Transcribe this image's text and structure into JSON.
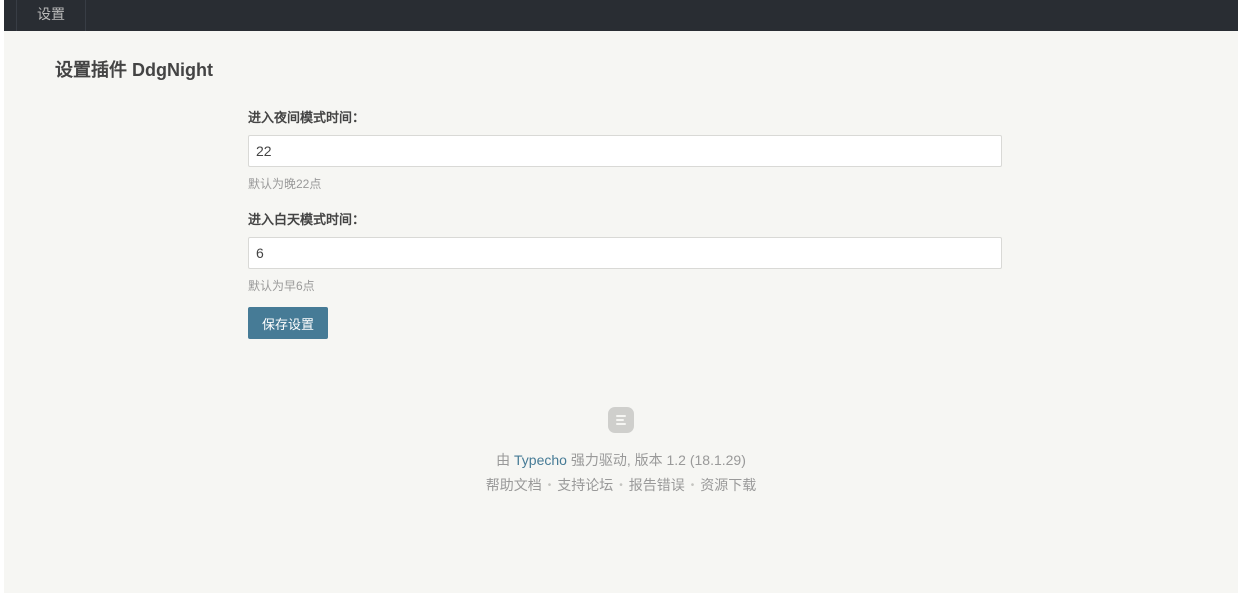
{
  "topbar": {
    "settings_tab": "设置"
  },
  "page": {
    "title": "设置插件 DdgNight"
  },
  "form": {
    "night_start": {
      "label": "进入夜间模式时间：",
      "value": "22",
      "description": "默认为晚22点"
    },
    "day_start": {
      "label": "进入白天模式时间：",
      "value": "6",
      "description": "默认为早6点"
    },
    "submit_label": "保存设置"
  },
  "footer": {
    "logo_icon": "typecho-logo-icon",
    "powered_prefix": "由",
    "powered_link": "Typecho",
    "powered_suffix": "强力驱动, 版本 1.2 (18.1.29)",
    "links": [
      "帮助文档",
      "支持论坛",
      "报告错误",
      "资源下载"
    ],
    "separator": "•"
  },
  "colors": {
    "topbar": "#292d33",
    "background": "#f6f6f3",
    "accent": "#467b96"
  }
}
